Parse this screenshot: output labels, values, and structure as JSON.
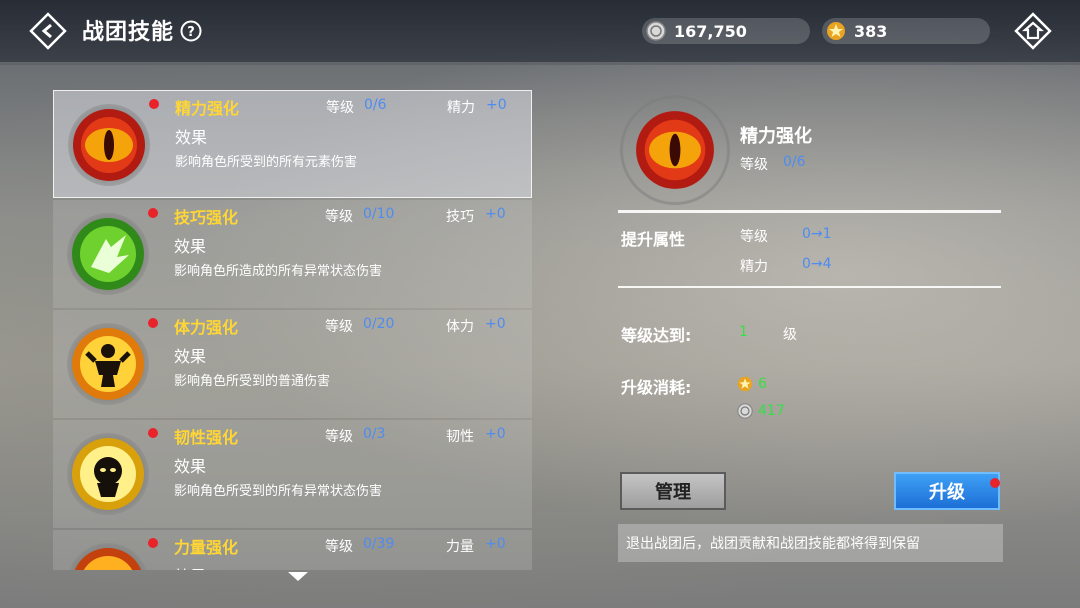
{
  "header": {
    "title": "战团技能",
    "currency_coins": "167,750",
    "currency_stars": "383",
    "icons": {
      "back": "back-diamond-icon",
      "help": "help-icon",
      "coin": "coin-icon",
      "star": "star-medal-icon",
      "home": "home-diamond-icon"
    }
  },
  "skills": [
    {
      "name": "精力强化",
      "level_label": "等级",
      "level": "0/6",
      "stat_label": "精力",
      "stat_value": "+0",
      "effect_label": "效果",
      "desc": "影响角色所受到的所有元素伤害",
      "icon": "dragon-eye-icon",
      "selected": true
    },
    {
      "name": "技巧强化",
      "level_label": "等级",
      "level": "0/10",
      "stat_label": "技巧",
      "stat_value": "+0",
      "effect_label": "效果",
      "desc": "影响角色所造成的所有异常状态伤害",
      "icon": "green-wing-icon"
    },
    {
      "name": "体力强化",
      "level_label": "等级",
      "level": "0/20",
      "stat_label": "体力",
      "stat_value": "+0",
      "effect_label": "效果",
      "desc": "影响角色所受到的普通伤害",
      "icon": "strong-figure-icon"
    },
    {
      "name": "韧性强化",
      "level_label": "等级",
      "level": "0/3",
      "stat_label": "韧性",
      "stat_value": "+0",
      "effect_label": "效果",
      "desc": "影响角色所受到的所有异常状态伤害",
      "icon": "burst-figure-icon"
    },
    {
      "name": "力量强化",
      "level_label": "等级",
      "level": "0/39",
      "stat_label": "力量",
      "stat_value": "+0",
      "effect_label": "效果",
      "desc": "",
      "icon": "fist-flame-icon"
    }
  ],
  "detail": {
    "name": "精力强化",
    "level_label": "等级",
    "level": "0/6",
    "upgrade_attr_label": "提升属性",
    "attrs": [
      {
        "label": "等级",
        "value": "0→1"
      },
      {
        "label": "精力",
        "value": "0→4"
      }
    ],
    "level_req_label": "等级达到:",
    "level_req_value": "1",
    "level_req_unit": "级",
    "cost_label": "升级消耗:",
    "cost_star": "6",
    "cost_coin": "417",
    "manage_button": "管理",
    "upgrade_button": "升级",
    "notice": "退出战团后，战团贡献和战团技能都将得到保留"
  },
  "colors": {
    "accent_blue": "#4f8cf0",
    "name_yellow": "#ffd633",
    "ok_green": "#35e045",
    "alert_red": "#e8232a"
  }
}
